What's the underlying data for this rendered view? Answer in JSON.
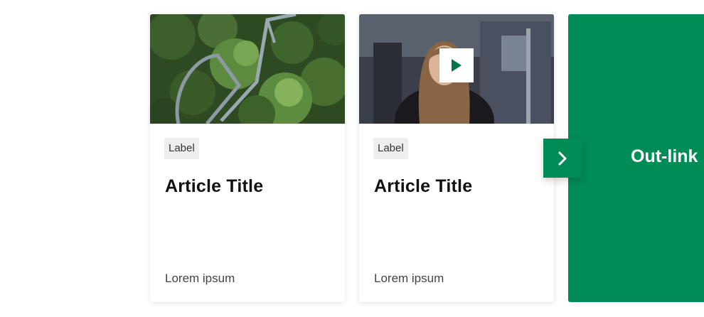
{
  "cards": [
    {
      "label": "Label",
      "title": "Article Title",
      "footer": "Lorem ipsum",
      "image_icon": "aerial-forest-walkway-image"
    },
    {
      "label": "Label",
      "title": "Article Title",
      "footer": "Lorem ipsum",
      "image_icon": "video-thumbnail-woman-office",
      "media_icon": "play-icon"
    }
  ],
  "outlink": {
    "label": "Out-link"
  },
  "carousel": {
    "next_icon": "chevron-right-icon"
  },
  "colors": {
    "accent": "#008c56",
    "label_bg": "#eeeeee",
    "play_triangle": "#00774a"
  }
}
